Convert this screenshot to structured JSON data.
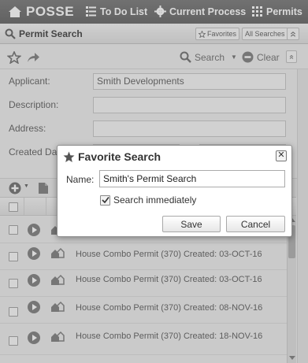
{
  "topbar": {
    "brand": "POSSE",
    "nav": [
      {
        "label": "To Do List",
        "icon": "list-icon"
      },
      {
        "label": "Current Process",
        "icon": "gear-icon"
      },
      {
        "label": "Permits",
        "icon": "grid-icon"
      }
    ]
  },
  "panel": {
    "title": "Permit Search",
    "favorites_label": "Favorites",
    "all_searches_label": "All Searches"
  },
  "toolbar": {
    "search_label": "Search",
    "clear_label": "Clear"
  },
  "form": {
    "fields": [
      {
        "label": "Applicant:",
        "value": "Smith Developments"
      },
      {
        "label": "Description:",
        "value": ""
      },
      {
        "label": "Address:",
        "value": ""
      },
      {
        "label": "Created Dat",
        "value": ""
      }
    ]
  },
  "results": {
    "rows": [
      {
        "text": ""
      },
      {
        "text": "House Combo Permit (370) Created: 03-OCT-16"
      },
      {
        "text": "House Combo Permit (370) Created: 03-OCT-16"
      },
      {
        "text": "House Combo Permit (370) Created: 08-NOV-16"
      },
      {
        "text": "House Combo Permit (370) Created: 18-NOV-16"
      }
    ]
  },
  "dialog": {
    "title": "Favorite Search",
    "name_label": "Name:",
    "name_value": "Smith's Permit Search",
    "checkbox_label": "Search immediately",
    "checkbox_checked": true,
    "save_label": "Save",
    "cancel_label": "Cancel"
  }
}
